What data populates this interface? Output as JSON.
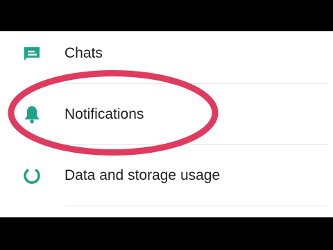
{
  "settings": {
    "items": [
      {
        "label": "Chats",
        "icon": "chat-icon"
      },
      {
        "label": "Notifications",
        "icon": "bell-icon"
      },
      {
        "label": "Data and storage usage",
        "icon": "data-usage-icon"
      }
    ]
  },
  "colors": {
    "accent": "#1fa38a",
    "highlight": "#e03a5e",
    "text": "#1f1f1f",
    "divider": "#e6e6e6"
  }
}
